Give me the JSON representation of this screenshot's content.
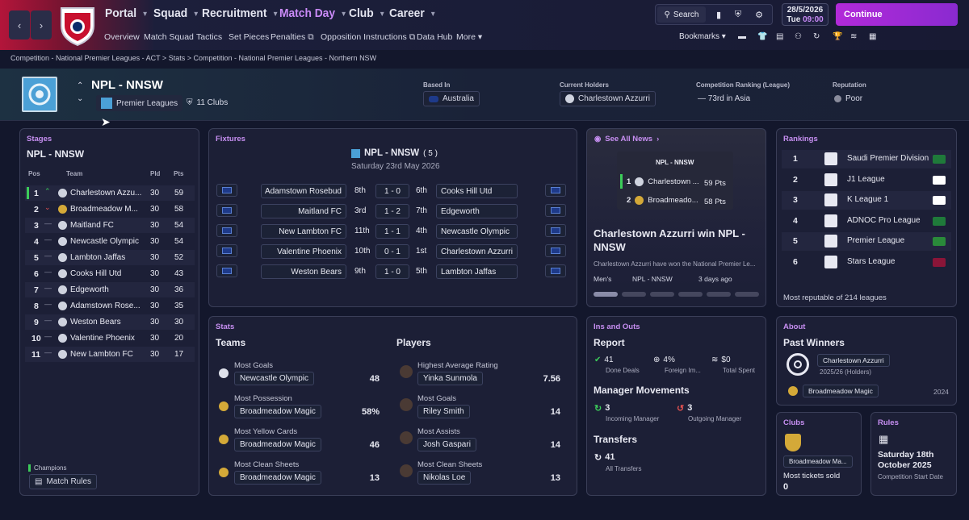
{
  "topbar": {
    "nav": [
      "Portal",
      "Squad",
      "Recruitment",
      "Match Day",
      "Club",
      "Career"
    ],
    "subnav": [
      "Overview",
      "Match Squad",
      "Tactics",
      "Set Pieces",
      "Penalties",
      "Opposition Instructions",
      "Data Hub",
      "More"
    ],
    "search": "Search",
    "date": "28/5/2026",
    "day": "Tue",
    "time": "09:00",
    "continue": "Continue",
    "bookmarks": "Bookmarks",
    "crest_text": "ADELAIDE UNITED F.C."
  },
  "breadcrumb": [
    "Competition - National Premier Leagues - ACT",
    "Stats",
    "Competition - National Premier Leagues - Northern NSW"
  ],
  "header": {
    "name": "NPL - NNSW",
    "type": "Premier Leagues",
    "clubs": "11 Clubs",
    "based_label": "Based In",
    "based": "Australia",
    "holders_label": "Current Holders",
    "holders": "Charlestown Azzurri",
    "ranking_label": "Competition Ranking (League)",
    "ranking": "73rd in Asia",
    "rep_label": "Reputation",
    "rep": "Poor"
  },
  "stages": {
    "title": "Stages",
    "name": "NPL - NNSW",
    "headers": [
      "Pos",
      "Team",
      "Pld",
      "Pts"
    ],
    "rows": [
      {
        "pos": "1",
        "team": "Charlestown Azzu...",
        "pld": "30",
        "pts": "59",
        "move": "up"
      },
      {
        "pos": "2",
        "team": "Broadmeadow M...",
        "pld": "30",
        "pts": "58",
        "move": "down"
      },
      {
        "pos": "3",
        "team": "Maitland FC",
        "pld": "30",
        "pts": "54",
        "move": "same"
      },
      {
        "pos": "4",
        "team": "Newcastle Olympic",
        "pld": "30",
        "pts": "54",
        "move": "same"
      },
      {
        "pos": "5",
        "team": "Lambton Jaffas",
        "pld": "30",
        "pts": "52",
        "move": "same"
      },
      {
        "pos": "6",
        "team": "Cooks Hill Utd",
        "pld": "30",
        "pts": "43",
        "move": "same"
      },
      {
        "pos": "7",
        "team": "Edgeworth",
        "pld": "30",
        "pts": "36",
        "move": "same"
      },
      {
        "pos": "8",
        "team": "Adamstown Rose...",
        "pld": "30",
        "pts": "35",
        "move": "same"
      },
      {
        "pos": "9",
        "team": "Weston Bears",
        "pld": "30",
        "pts": "30",
        "move": "same"
      },
      {
        "pos": "10",
        "team": "Valentine Phoenix",
        "pld": "30",
        "pts": "20",
        "move": "same"
      },
      {
        "pos": "11",
        "team": "New Lambton FC",
        "pld": "30",
        "pts": "17",
        "move": "same"
      }
    ],
    "champions": "Champions",
    "match_rules": "Match Rules"
  },
  "fixtures": {
    "title": "Fixtures",
    "comp": "NPL - NNSW",
    "round": "( 5 )",
    "date": "Saturday 23rd May 2026",
    "rows": [
      {
        "home": "Adamstown Rosebud",
        "hpos": "8th",
        "score": "1 - 0",
        "apos": "6th",
        "away": "Cooks Hill Utd"
      },
      {
        "home": "Maitland FC",
        "hpos": "3rd",
        "score": "1 - 2",
        "apos": "7th",
        "away": "Edgeworth"
      },
      {
        "home": "New Lambton FC",
        "hpos": "11th",
        "score": "1 - 1",
        "apos": "4th",
        "away": "Newcastle Olympic"
      },
      {
        "home": "Valentine Phoenix",
        "hpos": "10th",
        "score": "0 - 1",
        "apos": "1st",
        "away": "Charlestown Azzurri"
      },
      {
        "home": "Weston Bears",
        "hpos": "9th",
        "score": "1 - 0",
        "apos": "5th",
        "away": "Lambton Jaffas"
      }
    ]
  },
  "news": {
    "see_all": "See All News",
    "mini_title": "NPL - NNSW",
    "mini_rows": [
      {
        "pos": "1",
        "team": "Charlestown ...",
        "pts": "59 Pts"
      },
      {
        "pos": "2",
        "team": "Broadmeado...",
        "pts": "58 Pts"
      }
    ],
    "headline": "Charlestown Azzurri win NPL - NNSW",
    "snippet": "Charlestown Azzurri have won the National Premier Le...",
    "tags": [
      "Men's",
      "NPL - NNSW",
      "3 days ago"
    ]
  },
  "rankings": {
    "title": "Rankings",
    "rows": [
      {
        "pos": "1",
        "name": "Saudi Premier Division",
        "flag": "#1f7a3a"
      },
      {
        "pos": "2",
        "name": "J1 League",
        "flag": "#ffffff"
      },
      {
        "pos": "3",
        "name": "K League 1",
        "flag": "#ffffff"
      },
      {
        "pos": "4",
        "name": "ADNOC Pro League",
        "flag": "#1f7a3a"
      },
      {
        "pos": "5",
        "name": "Premier League",
        "flag": "#2a8a3a"
      },
      {
        "pos": "6",
        "name": "Stars League",
        "flag": "#8a1538"
      }
    ],
    "footer": "Most reputable of 214 leagues"
  },
  "stats": {
    "title": "Stats",
    "teams_title": "Teams",
    "players_title": "Players",
    "teams": [
      {
        "label": "Most Goals",
        "name": "Newcastle Olympic",
        "value": "48"
      },
      {
        "label": "Most Possession",
        "name": "Broadmeadow Magic",
        "value": "58%"
      },
      {
        "label": "Most Yellow Cards",
        "name": "Broadmeadow Magic",
        "value": "46"
      },
      {
        "label": "Most Clean Sheets",
        "name": "Broadmeadow Magic",
        "value": "13"
      }
    ],
    "players": [
      {
        "label": "Highest Average Rating",
        "name": "Yinka Sunmola",
        "value": "7.56"
      },
      {
        "label": "Most Goals",
        "name": "Riley Smith",
        "value": "14"
      },
      {
        "label": "Most Assists",
        "name": "Josh Gaspari",
        "value": "14"
      },
      {
        "label": "Most Clean Sheets",
        "name": "Nikolas Loe",
        "value": "13"
      }
    ]
  },
  "ins": {
    "title": "Ins and Outs",
    "report": "Report",
    "deals": "41",
    "deals_label": "Done Deals",
    "foreign": "4%",
    "foreign_label": "Foreign Im...",
    "spent": "$0",
    "spent_label": "Total Spent",
    "mm_title": "Manager Movements",
    "incoming": "3",
    "incoming_label": "Incoming Manager",
    "outgoing": "3",
    "outgoing_label": "Outgoing Manager",
    "transfers_title": "Transfers",
    "transfers": "41",
    "transfers_label": "All Transfers"
  },
  "about": {
    "title": "About",
    "past": "Past Winners",
    "winner": "Charlestown Azzurri",
    "winner_season": "2025/26 (Holders)",
    "prev": "Broadmeadow Magic",
    "prev_year": "2024"
  },
  "clubs": {
    "title": "Clubs",
    "club": "Broadmeadow Ma...",
    "label": "Most tickets sold",
    "value": "0"
  },
  "rules": {
    "title": "Rules",
    "date": "Saturday 18th October 2025",
    "label": "Competition Start Date"
  }
}
